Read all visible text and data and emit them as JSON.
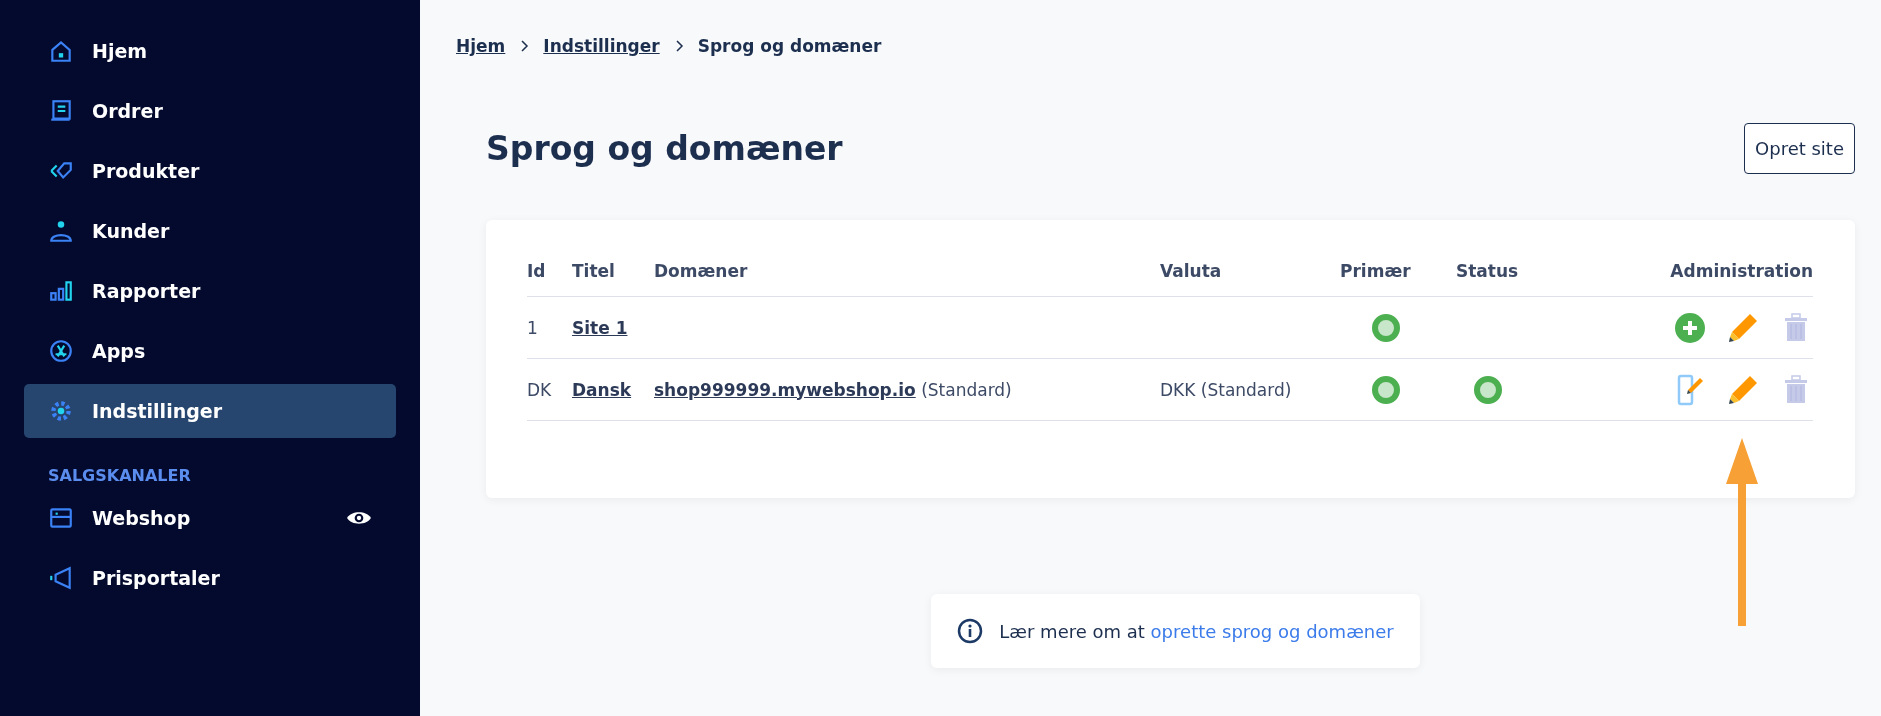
{
  "sidebar": {
    "items": [
      {
        "label": "Hjem",
        "selected": false
      },
      {
        "label": "Ordrer",
        "selected": false
      },
      {
        "label": "Produkter",
        "selected": false
      },
      {
        "label": "Kunder",
        "selected": false
      },
      {
        "label": "Rapporter",
        "selected": false
      },
      {
        "label": "Apps",
        "selected": false
      },
      {
        "label": "Indstillinger",
        "selected": true
      }
    ],
    "section_title": "SALGSKANALER",
    "channels": [
      {
        "label": "Webshop",
        "visible": true,
        "selected": false
      },
      {
        "label": "Prisportaler",
        "visible": false,
        "selected": false
      }
    ]
  },
  "breadcrumb": [
    {
      "label": "Hjem",
      "link": true
    },
    {
      "label": "Indstillinger",
      "link": true
    },
    {
      "label": "Sprog og domæner",
      "link": false
    }
  ],
  "page_title": "Sprog og domæner",
  "create_button": "Opret site",
  "table": {
    "columns": [
      "Id",
      "Titel",
      "Domæner",
      "Valuta",
      "Primær",
      "Status",
      "Administration"
    ],
    "rows": [
      {
        "id": "1",
        "title": "Site 1",
        "domain": "",
        "domain_note": "",
        "currency": "",
        "primary": true,
        "status": false,
        "actions": [
          {
            "kind": "add"
          },
          {
            "kind": "edit"
          },
          {
            "kind": "delete"
          }
        ]
      },
      {
        "id": "DK",
        "title": "Dansk",
        "domain": "shop999999.mywebshop.io",
        "domain_note": "(Standard)",
        "currency": "DKK (Standard)",
        "primary": true,
        "status": true,
        "actions": [
          {
            "kind": "mobile-edit"
          },
          {
            "kind": "edit"
          },
          {
            "kind": "delete"
          }
        ]
      }
    ]
  },
  "info": {
    "text": "Lær mere om at",
    "link": "oprette sprog og domæner"
  }
}
